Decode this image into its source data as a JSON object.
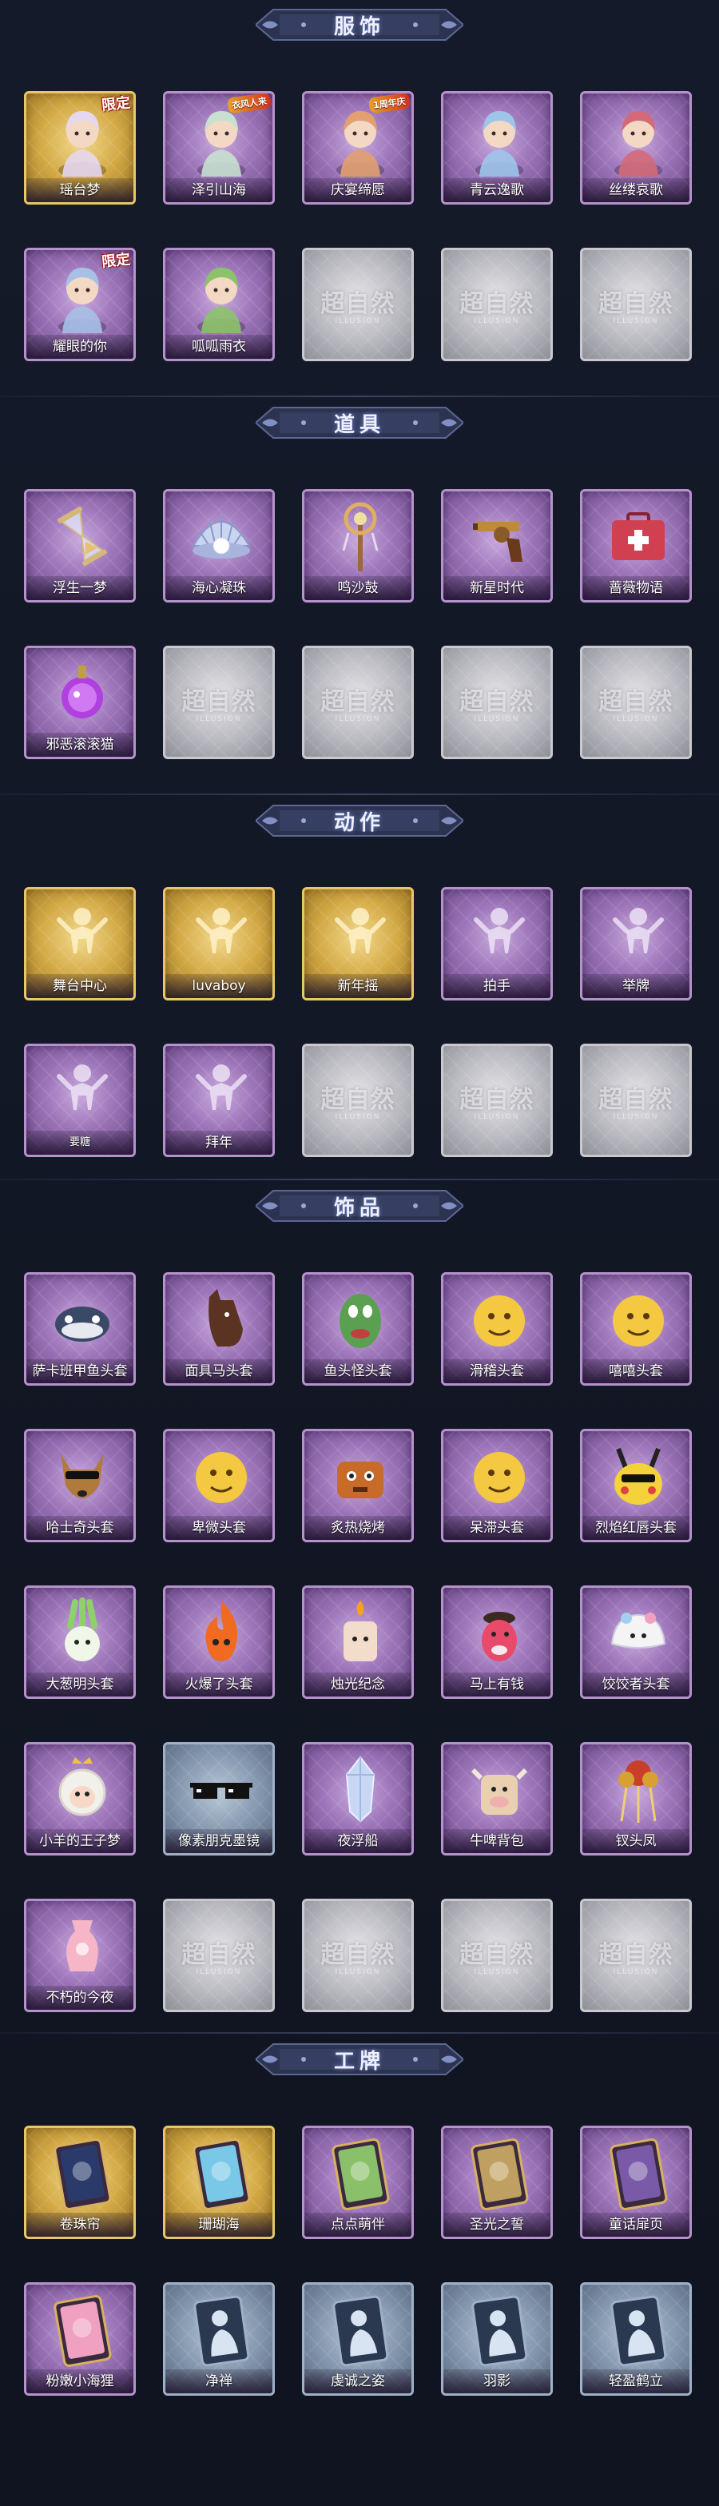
{
  "sections": [
    {
      "title": "服饰",
      "items": [
        {
          "label": "瑶台梦",
          "style": "gold",
          "badge": "限定",
          "icon": "figure-icon",
          "tint": "#e6d7f0"
        },
        {
          "label": "泽引山海",
          "style": "purple",
          "badge": "",
          "corner": "衣风人来",
          "icon": "figure-icon",
          "tint": "#c8e0d0"
        },
        {
          "label": "庆宴缔愿",
          "style": "purple",
          "badge": "",
          "corner": "1周年庆",
          "icon": "figure-icon",
          "tint": "#e0a070"
        },
        {
          "label": "青云逸歌",
          "style": "purple",
          "badge": "",
          "icon": "figure-icon",
          "tint": "#9fc4ea"
        },
        {
          "label": "丝缕哀歌",
          "style": "purple",
          "badge": "",
          "icon": "figure-icon",
          "tint": "#d36a7a"
        },
        {
          "label": "耀眼的你",
          "style": "purple",
          "badge": "限定",
          "icon": "figure-icon",
          "tint": "#a7c0e6"
        },
        {
          "label": "呱呱雨衣",
          "style": "purple",
          "badge": "",
          "icon": "figure-icon",
          "tint": "#8cc36a"
        },
        {
          "label": "",
          "style": "gray",
          "icon": "placeholder-logo"
        },
        {
          "label": "",
          "style": "gray",
          "icon": "placeholder-logo"
        },
        {
          "label": "",
          "style": "gray",
          "icon": "placeholder-logo"
        }
      ]
    },
    {
      "title": "道具",
      "items": [
        {
          "label": "浮生一梦",
          "style": "purple",
          "icon": "hourglass-icon",
          "tint": "#d4b87a"
        },
        {
          "label": "海心凝珠",
          "style": "purple",
          "icon": "pearl-shell-icon",
          "tint": "#c8d4f0"
        },
        {
          "label": "鸣沙鼓",
          "style": "purple",
          "icon": "staff-icon",
          "tint": "#e0b060"
        },
        {
          "label": "新星时代",
          "style": "purple",
          "icon": "revolver-icon",
          "tint": "#c08a3a"
        },
        {
          "label": "蔷薇物语",
          "style": "purple",
          "icon": "medkit-icon",
          "tint": "#d04050"
        },
        {
          "label": "邪恶滚滚猫",
          "style": "purple",
          "icon": "orb-icon",
          "tint": "#b040e0"
        },
        {
          "label": "",
          "style": "gray",
          "icon": "placeholder-logo"
        },
        {
          "label": "",
          "style": "gray",
          "icon": "placeholder-logo"
        },
        {
          "label": "",
          "style": "gray",
          "icon": "placeholder-logo"
        },
        {
          "label": "",
          "style": "gray",
          "icon": "placeholder-logo"
        }
      ]
    },
    {
      "title": "动作",
      "items": [
        {
          "label": "舞台中心",
          "style": "gold",
          "icon": "pose-icon",
          "tint": "#fff1c8"
        },
        {
          "label": "luvaboy",
          "style": "gold",
          "icon": "pose-icon",
          "tint": "#fff1c8"
        },
        {
          "label": "新年摇",
          "style": "gold",
          "icon": "pose-icon",
          "tint": "#fff1c8"
        },
        {
          "label": "拍手",
          "style": "purple",
          "icon": "pose-icon",
          "tint": "#ece0f4"
        },
        {
          "label": "举牌",
          "style": "purple",
          "icon": "pose-icon",
          "tint": "#ece0f4"
        },
        {
          "label": "要糖",
          "style": "purple",
          "icon": "pose-icon",
          "tint": "#ece0f4",
          "small": true
        },
        {
          "label": "拜年",
          "style": "purple",
          "icon": "pose-icon",
          "tint": "#ece0f4"
        },
        {
          "label": "",
          "style": "gray",
          "icon": "placeholder-logo"
        },
        {
          "label": "",
          "style": "gray",
          "icon": "placeholder-logo"
        },
        {
          "label": "",
          "style": "gray",
          "icon": "placeholder-logo"
        }
      ]
    },
    {
      "title": "饰品",
      "items": [
        {
          "label": "萨卡班甲鱼头套",
          "style": "purple",
          "icon": "fish-head-icon",
          "tint": "#3a4a66"
        },
        {
          "label": "面具马头套",
          "style": "purple",
          "icon": "horse-head-icon",
          "tint": "#5a3322"
        },
        {
          "label": "鱼头怪头套",
          "style": "purple",
          "icon": "fish-monster-icon",
          "tint": "#5aa050"
        },
        {
          "label": "滑稽头套",
          "style": "purple",
          "icon": "emoji-icon",
          "tint": "#f5c842"
        },
        {
          "label": "嘻嘻头套",
          "style": "purple",
          "icon": "emoji-icon",
          "tint": "#f5c842"
        },
        {
          "label": "哈士奇头套",
          "style": "purple",
          "icon": "dog-head-icon",
          "tint": "#b07a3a"
        },
        {
          "label": "卑微头套",
          "style": "purple",
          "icon": "emoji-icon",
          "tint": "#f5c842"
        },
        {
          "label": "炙热烧烤",
          "style": "purple",
          "icon": "bbq-icon",
          "tint": "#c86a2a"
        },
        {
          "label": "呆滞头套",
          "style": "purple",
          "icon": "emoji-icon",
          "tint": "#f5c842"
        },
        {
          "label": "烈焰红唇头套",
          "style": "purple",
          "icon": "pikachu-icon",
          "tint": "#f3d23a"
        },
        {
          "label": "大葱明头套",
          "style": "purple",
          "icon": "scallion-icon",
          "tint": "#8fd06a"
        },
        {
          "label": "火爆了头套",
          "style": "purple",
          "icon": "fire-icon",
          "tint": "#f06a20"
        },
        {
          "label": "烛光纪念",
          "style": "purple",
          "icon": "candle-icon",
          "tint": "#f2dccb"
        },
        {
          "label": "马上有钱",
          "style": "purple",
          "icon": "pony-icon",
          "tint": "#e84a6a"
        },
        {
          "label": "饺饺者头套",
          "style": "purple",
          "icon": "dumpling-icon",
          "tint": "#f4f4f4"
        },
        {
          "label": "小羊的王子梦",
          "style": "purple",
          "icon": "sheep-icon",
          "tint": "#f2f0ea"
        },
        {
          "label": "像素朋克墨镜",
          "style": "steel",
          "icon": "pixel-glasses-icon",
          "tint": "#111111"
        },
        {
          "label": "夜浮船",
          "style": "purple",
          "icon": "crystal-icon",
          "tint": "#c8d8f4"
        },
        {
          "label": "牛啤背包",
          "style": "purple",
          "icon": "cow-icon",
          "tint": "#e8d0b0"
        },
        {
          "label": "钗头凤",
          "style": "purple",
          "icon": "headdress-icon",
          "tint": "#c8402a"
        },
        {
          "label": "不朽的今夜",
          "style": "purple",
          "icon": "vase-icon",
          "tint": "#f6b6c8"
        },
        {
          "label": "",
          "style": "gray",
          "icon": "placeholder-logo"
        },
        {
          "label": "",
          "style": "gray",
          "icon": "placeholder-logo"
        },
        {
          "label": "",
          "style": "gray",
          "icon": "placeholder-logo"
        },
        {
          "label": "",
          "style": "gray",
          "icon": "placeholder-logo"
        }
      ]
    },
    {
      "title": "工牌",
      "items": [
        {
          "label": "卷珠帘",
          "style": "gold",
          "icon": "badge-card-icon",
          "tint": "#2a3a6a"
        },
        {
          "label": "珊瑚海",
          "style": "gold",
          "icon": "badge-card-icon",
          "tint": "#7ac8e8"
        },
        {
          "label": "点点萌伴",
          "style": "purple",
          "icon": "badge-card-icon",
          "tint": "#8ac06a"
        },
        {
          "label": "圣光之誓",
          "style": "purple",
          "icon": "badge-card-icon",
          "tint": "#c0a060"
        },
        {
          "label": "童话扉页",
          "style": "purple",
          "icon": "badge-card-icon",
          "tint": "#7a5aa8"
        },
        {
          "label": "粉嫩小海狸",
          "style": "purple",
          "icon": "badge-card-icon",
          "tint": "#f0a0c0"
        },
        {
          "label": "净禅",
          "style": "steel",
          "icon": "silhouette-card-icon",
          "tint": "#d8e4f2"
        },
        {
          "label": "虔诚之姿",
          "style": "steel",
          "icon": "silhouette-card-icon",
          "tint": "#d8e4f2"
        },
        {
          "label": "羽影",
          "style": "steel",
          "icon": "silhouette-card-icon",
          "tint": "#d8e4f2"
        },
        {
          "label": "轻盈鹤立",
          "style": "steel",
          "icon": "silhouette-card-icon",
          "tint": "#d8e4f2"
        }
      ]
    }
  ],
  "placeholder": {
    "logo_text": "超自然",
    "sub_text": "ILLUSION"
  },
  "colors": {
    "background": "#121623",
    "banner": "#3a4266",
    "gold": "#d3a945",
    "purple": "#9b73b8",
    "gray": "#b9b9c0"
  }
}
